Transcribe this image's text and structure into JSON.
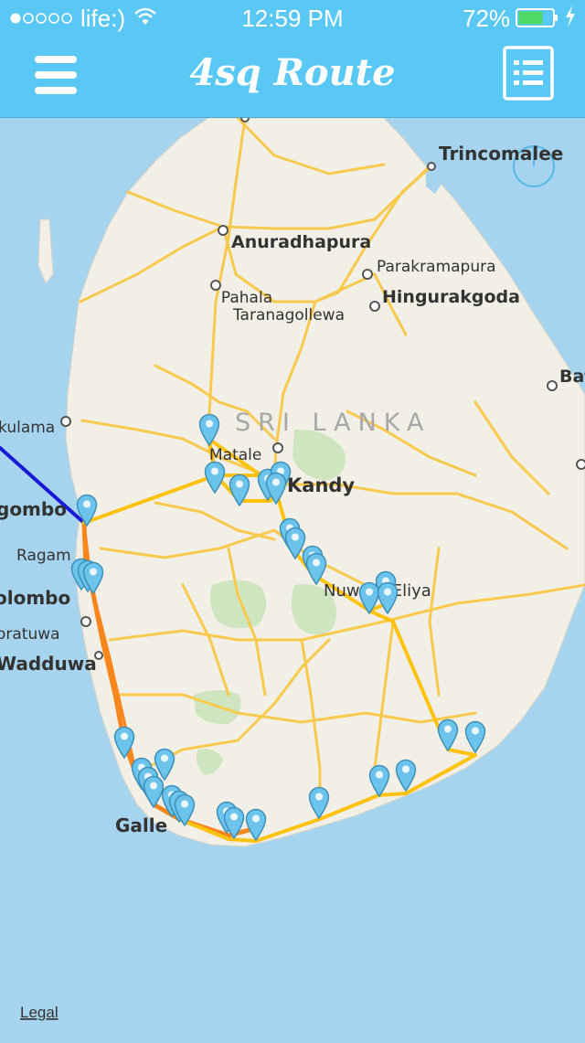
{
  "status_bar": {
    "signal_dots": 5,
    "signal_filled": 1,
    "carrier": "life:)",
    "time": "12:59 PM",
    "battery": "72%",
    "battery_level": 0.72
  },
  "nav": {
    "title": "4sq Route",
    "menu_icon": "hamburger-icon",
    "list_icon": "list-icon"
  },
  "map": {
    "country_label": "SRI LANKA",
    "places": {
      "trincomalee": "Trincomalee",
      "anuradhapura": "Anuradhapura",
      "parakramapura": "Parakramapura",
      "hingurakgoda": "Hingurakgoda",
      "pahala": "Pahala",
      "taranagollewa": "Taranagollewa",
      "kulama": "kulama",
      "matale": "Matale",
      "kandy": "Kandy",
      "gombo": "gombo",
      "ragam": "Ragam",
      "olombo": "olombo",
      "oratuwa": "oratuwa",
      "wadduwa": "Wadduwa",
      "nuwara_eliya": "Nuwara Eliya",
      "galle": "Galle",
      "bat": "Bat"
    },
    "legal": "Legal",
    "colors": {
      "sea": "#a6d4ee",
      "land": "#f2efe6",
      "park": "#cfe5bf",
      "road": "#f7c94d",
      "route_yellow": "#ffc20e",
      "route_orange": "#f7861c",
      "route_blue": "#1a1ad6",
      "pin": "#6cc4ec"
    }
  }
}
